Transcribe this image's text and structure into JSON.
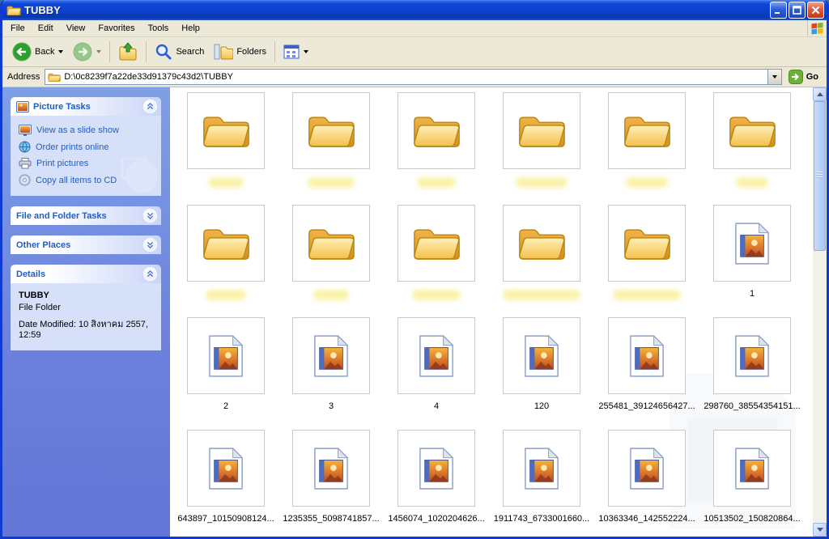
{
  "window": {
    "title": "TUBBY"
  },
  "menubar": {
    "items": [
      "File",
      "Edit",
      "View",
      "Favorites",
      "Tools",
      "Help"
    ]
  },
  "toolbar": {
    "buttons": [
      {
        "id": "back",
        "label": "Back",
        "icon": "back-icon",
        "caret": true,
        "disabled": false
      },
      {
        "id": "forward",
        "label": "",
        "icon": "forward-icon",
        "caret": true,
        "disabled": true
      },
      {
        "id": "sep1",
        "sep": true
      },
      {
        "id": "up",
        "label": "",
        "icon": "up-folder-icon"
      },
      {
        "id": "sep2",
        "sep": true
      },
      {
        "id": "search",
        "label": "Search",
        "icon": "search-icon"
      },
      {
        "id": "folders",
        "label": "Folders",
        "icon": "folders-icon"
      },
      {
        "id": "sep3",
        "sep": true
      },
      {
        "id": "views",
        "label": "",
        "icon": "views-icon",
        "caret": true
      }
    ]
  },
  "address": {
    "label": "Address",
    "value": "D:\\0c8239f7a22de33d91379c43d2\\TUBBY",
    "go_label": "Go"
  },
  "sidebar": {
    "picture_tasks": {
      "title": "Picture Tasks",
      "items": [
        {
          "label": "View as a slide show",
          "icon": "slideshow-icon"
        },
        {
          "label": "Order prints online",
          "icon": "prints-online-icon"
        },
        {
          "label": "Print pictures",
          "icon": "print-icon"
        },
        {
          "label": "Copy all items to CD",
          "icon": "copy-cd-icon"
        }
      ]
    },
    "file_folder_tasks": {
      "title": "File and Folder Tasks"
    },
    "other_places": {
      "title": "Other Places"
    },
    "details": {
      "title": "Details",
      "name": "TUBBY",
      "type": "File Folder",
      "modified": "Date Modified: 10 สิงหาคม 2557, 12:59"
    }
  },
  "files": [
    {
      "type": "folder",
      "name_hidden": true
    },
    {
      "type": "folder",
      "name_hidden": true
    },
    {
      "type": "folder",
      "name_hidden": true
    },
    {
      "type": "folder",
      "name_hidden": true
    },
    {
      "type": "folder",
      "name_hidden": true
    },
    {
      "type": "folder",
      "name_hidden": true
    },
    {
      "type": "folder",
      "name_hidden": true
    },
    {
      "type": "folder",
      "name_hidden": true
    },
    {
      "type": "folder",
      "name_hidden": true
    },
    {
      "type": "folder",
      "name_hidden": true
    },
    {
      "type": "folder",
      "name_hidden": true
    },
    {
      "type": "image",
      "label": "1"
    },
    {
      "type": "image",
      "label": "2"
    },
    {
      "type": "image",
      "label": "3"
    },
    {
      "type": "image",
      "label": "4"
    },
    {
      "type": "image",
      "label": "120"
    },
    {
      "type": "image",
      "label": "255481_39124656427..."
    },
    {
      "type": "image",
      "label": "298760_38554354151..."
    },
    {
      "type": "image",
      "label": "643897_10150908124..."
    },
    {
      "type": "image",
      "label": "1235355_5098741857..."
    },
    {
      "type": "image",
      "label": "1456074_1020204626..."
    },
    {
      "type": "image",
      "label": "1911743_6733001660..."
    },
    {
      "type": "image",
      "label": "10363346_142552224..."
    },
    {
      "type": "image",
      "label": "10513502_150820864..."
    }
  ]
}
